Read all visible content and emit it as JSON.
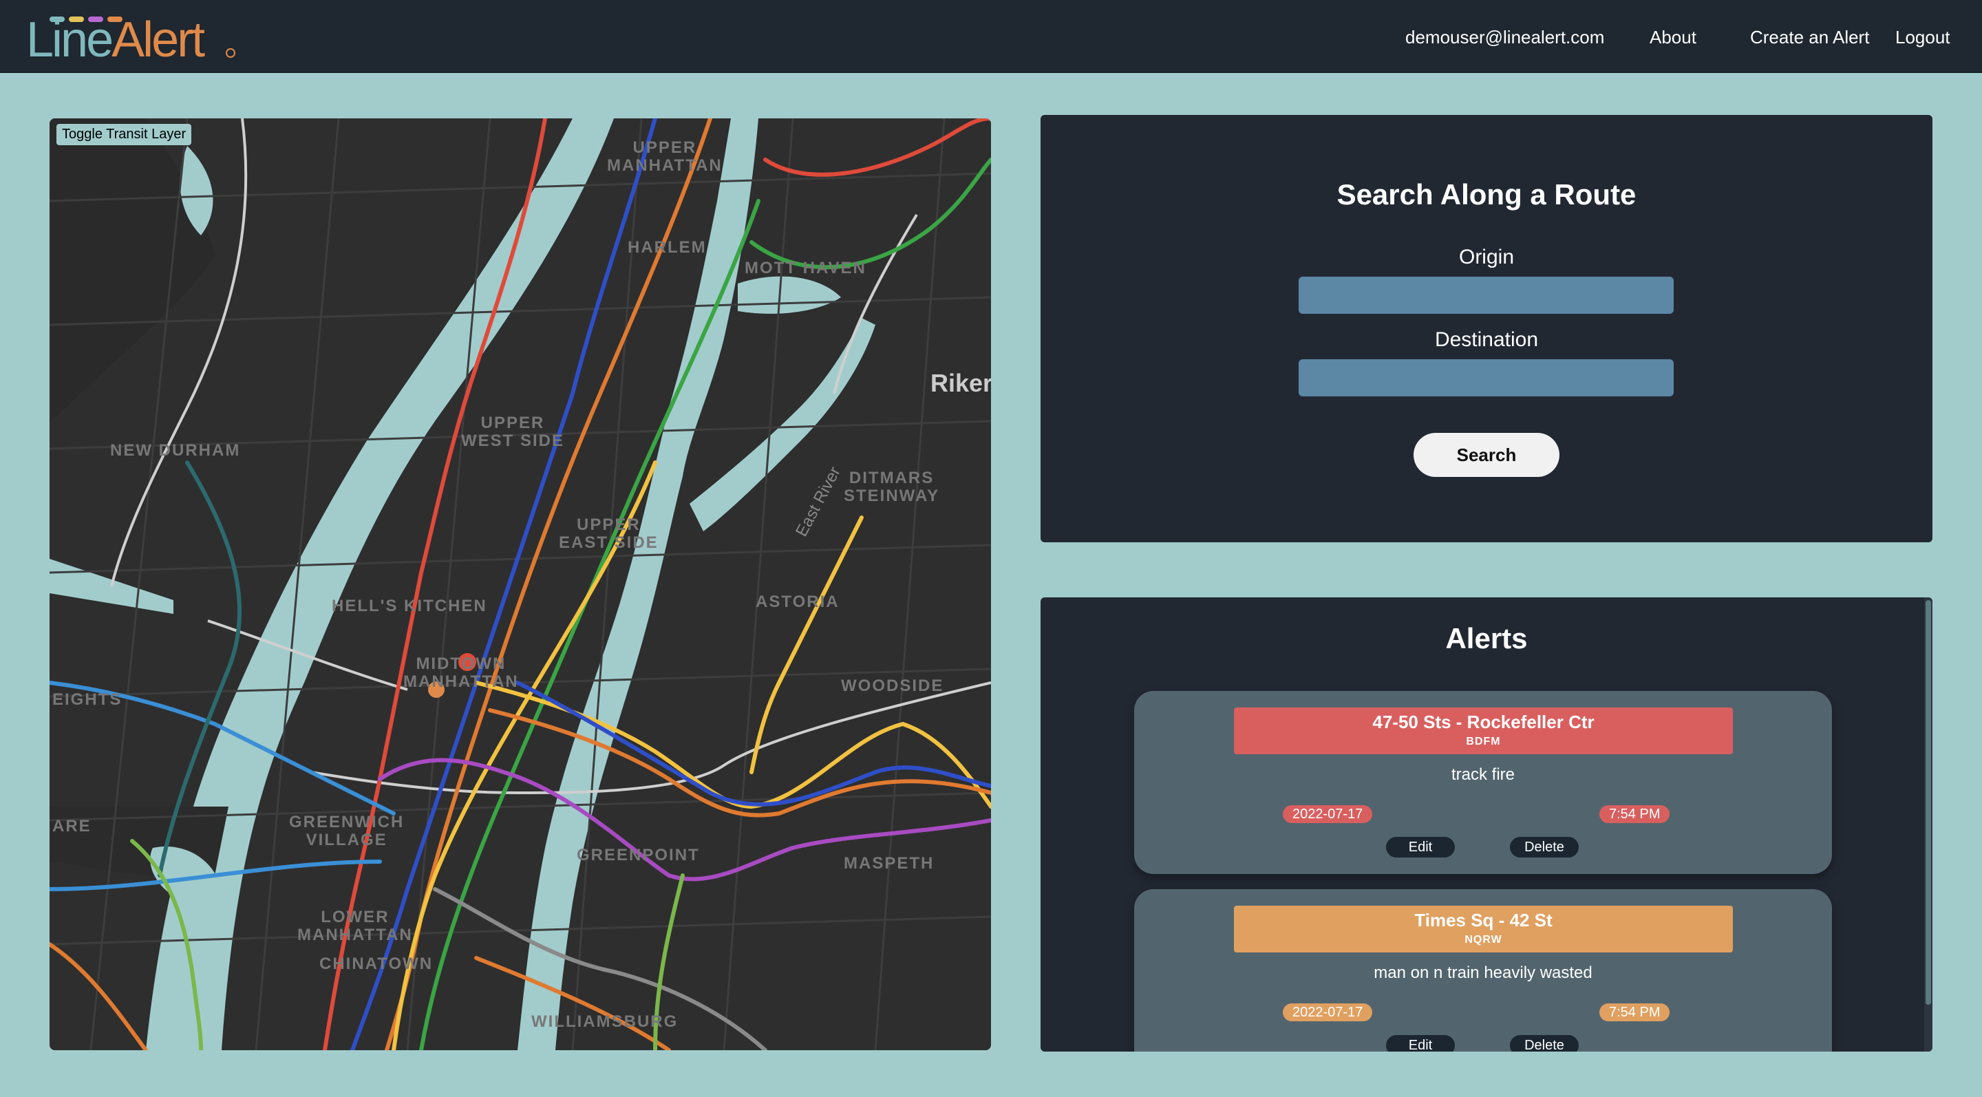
{
  "header": {
    "logo": {
      "part1": "Line",
      "part2": "Alert"
    },
    "nav": {
      "email": "demouser@linealert.com",
      "about": "About",
      "create_alert": "Create an Alert",
      "logout": "Logout"
    }
  },
  "map": {
    "toggle_label": "Toggle Transit Layer",
    "labels": {
      "upper_manhattan": "UPPER\nMANHATTAN",
      "harlem": "HARLEM",
      "mott_haven": "MOTT HAVEN",
      "new_durham": "NEW DURHAM",
      "upper_west_side": "UPPER\nWEST SIDE",
      "upper_east_side": "UPPER\nEAST SIDE",
      "ditmars": "DITMARS\nSTEINWAY",
      "hells_kitchen": "HELL'S KITCHEN",
      "astoria": "ASTORIA",
      "midtown": "MIDTOWN\nMANHATTAN",
      "heights": "EIGHTS",
      "woodside": "WOODSIDE",
      "greenwich": "GREENWICH\nVILLAGE",
      "greenpoint": "GREENPOINT",
      "maspeth": "MASPETH",
      "lower_manhattan": "LOWER\nMANHATTAN",
      "chinatown": "CHINATOWN",
      "williamsburg": "WILLIAMSBURG",
      "east_river": "East River",
      "rikers": "Riker",
      "hare": "ARE"
    }
  },
  "search": {
    "title": "Search Along a Route",
    "origin_label": "Origin",
    "destination_label": "Destination",
    "button_label": "Search"
  },
  "alerts": {
    "title": "Alerts",
    "items": [
      {
        "station": "47-50 Sts - Rockefeller Ctr",
        "lines": "BDFM",
        "description": "track fire",
        "date": "2022-07-17",
        "time": "7:54 PM",
        "color": "#d95f5f",
        "edit_label": "Edit",
        "delete_label": "Delete"
      },
      {
        "station": "Times Sq - 42 St",
        "lines": "NQRW",
        "description": "man on n train heavily wasted",
        "date": "2022-07-17",
        "time": "7:54 PM",
        "color": "#e0a060",
        "edit_label": "Edit",
        "delete_label": "Delete"
      }
    ]
  }
}
